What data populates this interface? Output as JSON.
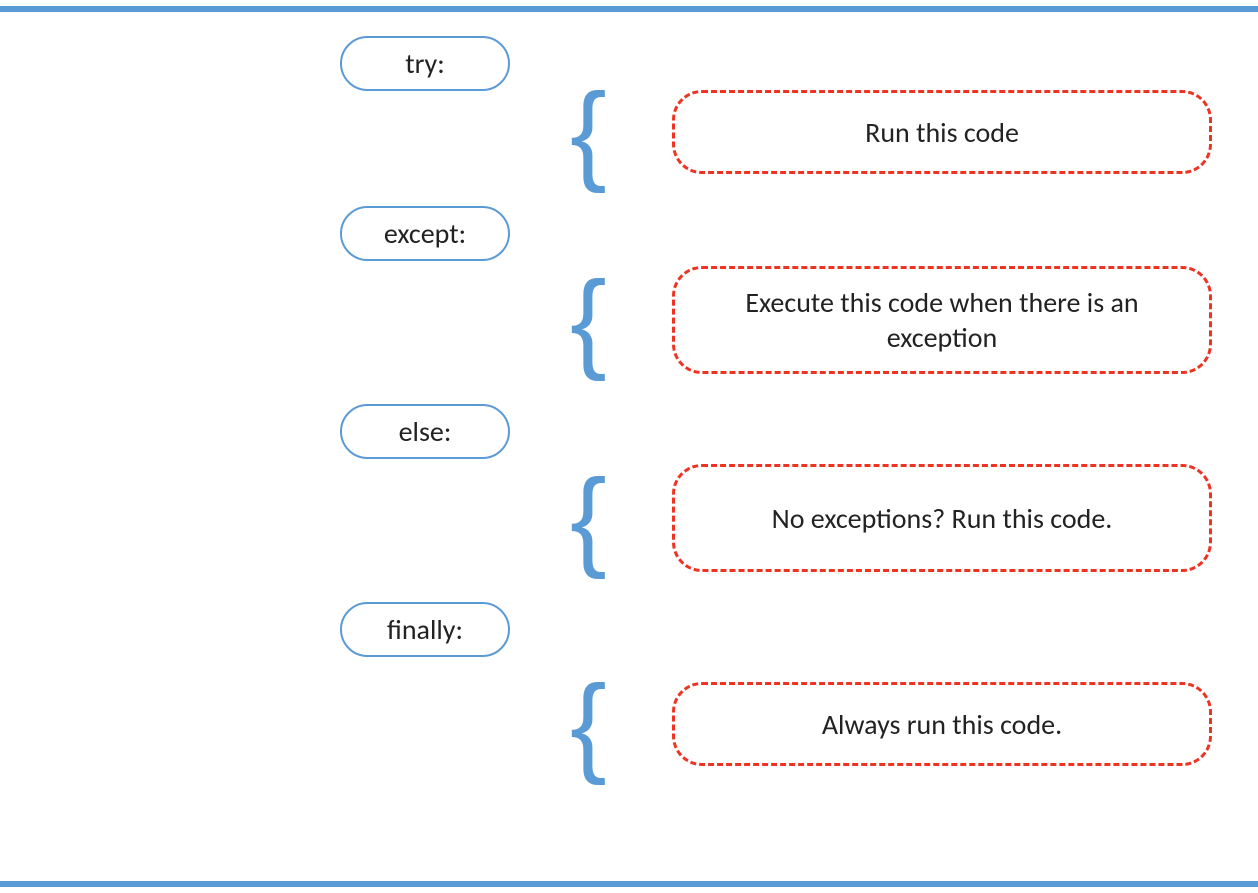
{
  "kw_try": "try:",
  "kw_except": "except:",
  "kw_else": "else:",
  "kw_finally": "finally:",
  "desc_try": "Run this code",
  "desc_except": "Execute this code when there is an exception",
  "desc_else": "No exceptions? Run this code.",
  "desc_finally": "Always run this code."
}
